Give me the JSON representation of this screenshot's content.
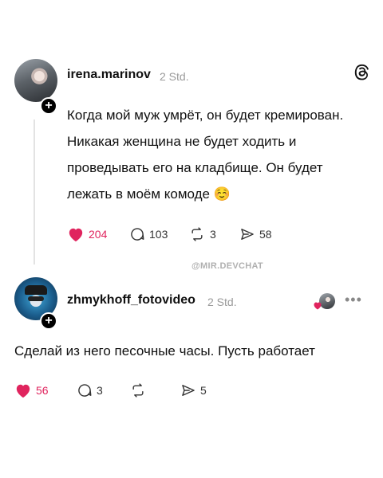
{
  "post": {
    "username": "irena.marinov",
    "time": "2 Std.",
    "text": "Когда мой муж умрёт, он будет кремирован. Никакая женщина не будет ходить и проведывать его на кладбище. Он будет лежать в моём комоде ☺️",
    "likes": "204",
    "replies": "103",
    "reposts": "3",
    "shares": "58"
  },
  "watermark": "@MIR.DEVCHAT",
  "reply": {
    "username": "zhmykhoff_fotovideo",
    "time": "2 Std.",
    "text": "Сделай из него песочные часы. Пусть работает",
    "likes": "56",
    "replies": "3",
    "reposts": "",
    "shares": "5"
  },
  "colors": {
    "like": "#e0245e",
    "muted": "#9a9a9a"
  },
  "icons": [
    "threads-logo-icon",
    "heart-icon",
    "comment-icon",
    "repost-icon",
    "share-icon",
    "more-icon",
    "plus-icon"
  ]
}
